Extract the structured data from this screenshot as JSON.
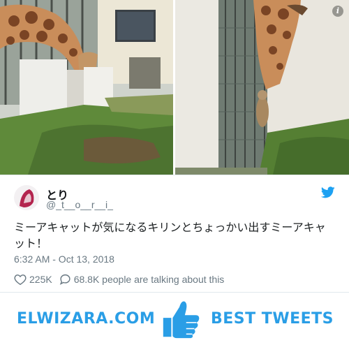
{
  "tweet": {
    "author_name": "とり",
    "author_handle": "@_t__o__r__i_",
    "text": "ミーアキャットが気になるキリンとちょっかい出すミーアキャット！",
    "timestamp": "6:32 AM - Oct 13, 2018",
    "likes": "225K",
    "talking": "68.8K people are talking about this",
    "info_icon": "i"
  },
  "icons": {
    "info": "info-icon",
    "twitter": "twitter-bird-icon",
    "heart": "heart-icon",
    "comment": "comment-bubble-icon",
    "thumb": "thumbs-up-icon"
  },
  "colors": {
    "twitter_blue": "#1da1f2",
    "brand_blue": "#2a9ee6",
    "muted_text": "#697882"
  },
  "banner": {
    "left_brand": "ELWIZARA.COM",
    "right_brand": "BEST TWEETS"
  }
}
